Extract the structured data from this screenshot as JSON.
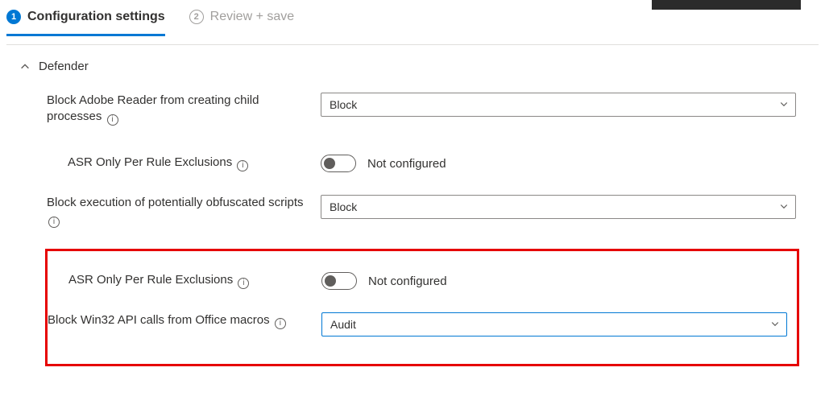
{
  "wizard": {
    "steps": [
      {
        "num": "1",
        "label": "Configuration settings"
      },
      {
        "num": "2",
        "label": "Review + save"
      }
    ]
  },
  "group": {
    "title": "Defender"
  },
  "settings": {
    "adobe": {
      "label": "Block Adobe Reader from creating child processes",
      "value": "Block"
    },
    "asr1": {
      "label": "ASR Only Per Rule Exclusions",
      "state": "Not configured"
    },
    "obfuscated": {
      "label": "Block execution of potentially obfuscated scripts",
      "value": "Block"
    },
    "asr2": {
      "label": "ASR Only Per Rule Exclusions",
      "state": "Not configured"
    },
    "win32": {
      "label": "Block Win32 API calls from Office macros",
      "value": "Audit"
    }
  }
}
